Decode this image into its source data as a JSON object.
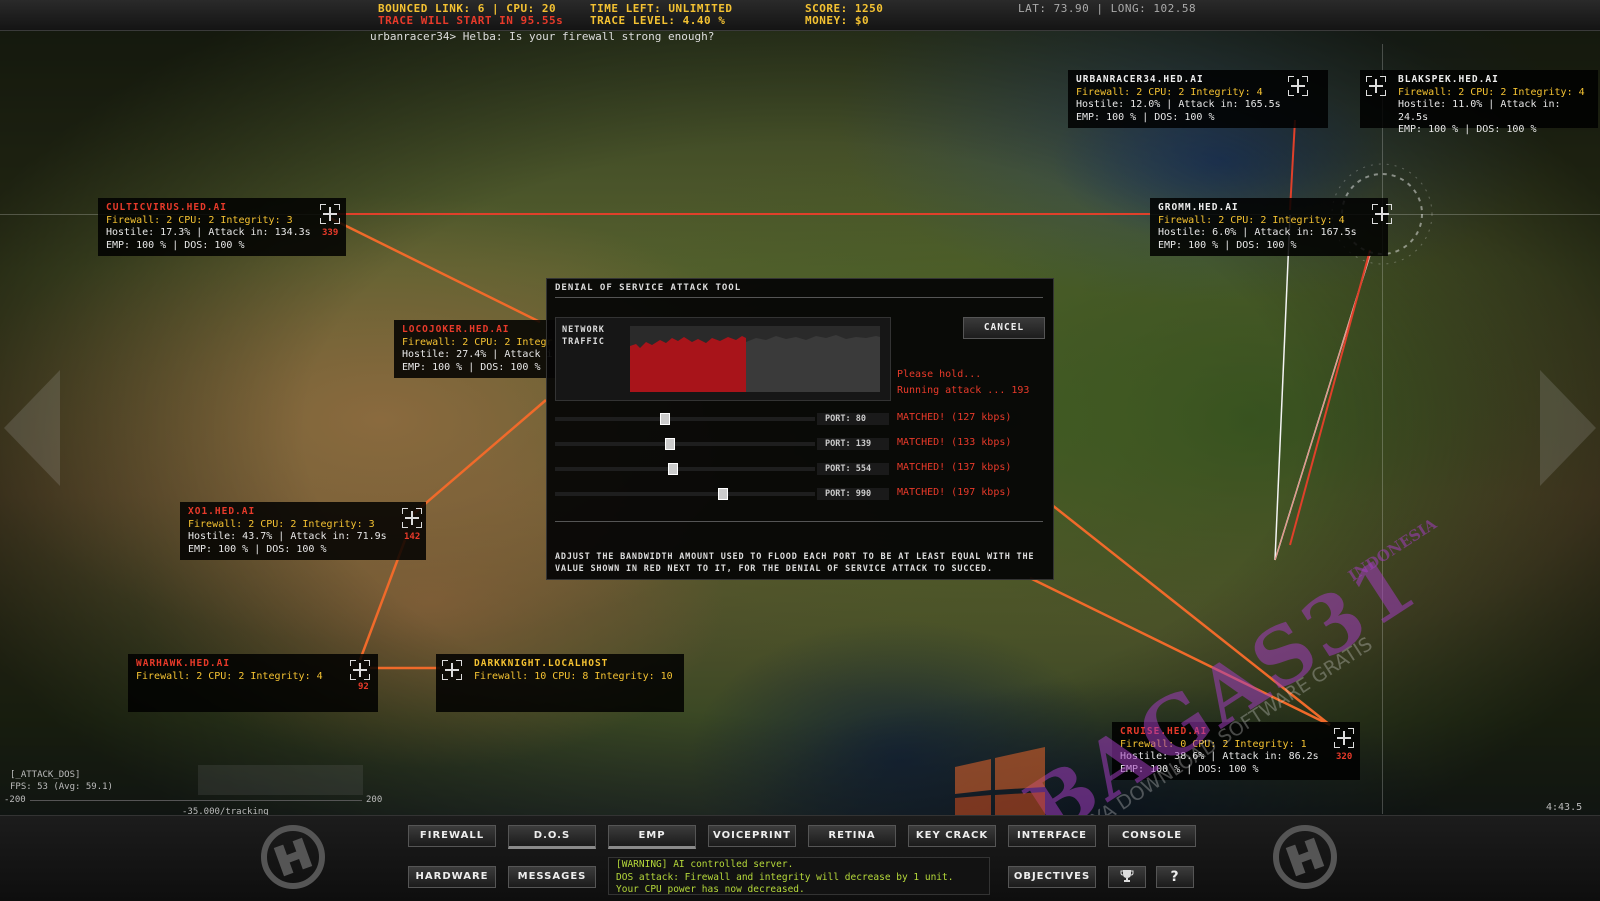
{
  "hud": {
    "bounced": "BOUNCED LINK: 6 | CPU: 20",
    "trace_start": "TRACE WILL START IN 95.55s",
    "time_left": "TIME LEFT: UNLIMITED",
    "trace_level": "TRACE LEVEL: 4.40 %",
    "score": "SCORE: 1250",
    "money": "MONEY: $0",
    "coords": "LAT: 73.90 | LONG: 102.58",
    "chat": "urbanracer34> Helba: Is your firewall strong enough?"
  },
  "nodes": {
    "urbanracer": {
      "title": "URBANRACER34.HED.AI",
      "l1": "Firewall: 2 CPU: 2 Integrity: 4",
      "l2": "Hostile: 12.0% | Attack in: 165.5s",
      "l3": "EMP: 100 % | DOS: 100 %"
    },
    "blakspek": {
      "title": "BLAKSPEK.HED.AI",
      "l1": "Firewall: 2 CPU: 2 Integrity: 4",
      "l2": "Hostile: 11.0% | Attack in: 24.5s",
      "l3": "EMP: 100 % | DOS: 100 %"
    },
    "culticvirus": {
      "title": "CULTICVIRUS.HED.AI",
      "l1": "Firewall: 2 CPU: 2 Integrity: 3",
      "l2": "Hostile: 17.3% | Attack in: 134.3s",
      "l3": "EMP: 100 % | DOS: 100 %",
      "count": "339"
    },
    "gromm": {
      "title": "GROMM.HED.AI",
      "l1": "Firewall: 2 CPU: 2 Integrity: 4",
      "l2": "Hostile: 6.0% | Attack in: 167.5s",
      "l3": "EMP: 100 % | DOS: 100 %"
    },
    "locojoker": {
      "title": "LOCOJOKER.HED.AI",
      "l1": "Firewall: 2 CPU: 2 Integr",
      "l2": "Hostile: 27.4% | Attack i",
      "l3": "EMP: 100 % | DOS: 100 %"
    },
    "xo1": {
      "title": "XO1.HED.AI",
      "l1": "Firewall: 2 CPU: 2 Integrity: 3",
      "l2": "Hostile: 43.7% | Attack in: 71.9s",
      "l3": "EMP: 100 % | DOS: 100 %",
      "count": "142"
    },
    "warhawk": {
      "title": "WARHAWK.HED.AI",
      "l1": "Firewall: 2 CPU: 2 Integrity: 4",
      "count": "92"
    },
    "darkknight": {
      "title": "DARKKNIGHT.LOCALHOST",
      "l1": "Firewall: 10 CPU: 8 Integrity: 10"
    },
    "cruise": {
      "title": "CRUISE.HED.AI",
      "l1": "Firewall: 0 CPU: 2 Integrity: 1",
      "l2": "Hostile: 38.6% | Attack in: 86.2s",
      "l3": "EMP: 100 % | DOS: 100 %",
      "count": "320"
    }
  },
  "dialog": {
    "title": "DENIAL OF SERVICE ATTACK TOOL",
    "traffic_label_1": "NETWORK",
    "traffic_label_2": "TRAFFIC",
    "cancel": "CANCEL",
    "status_1": "Please hold...",
    "status_2": "Running attack ... 193",
    "ports": [
      {
        "label": "PORT: 80",
        "matched": "MATCHED! (127 kbps)",
        "level": 0.42
      },
      {
        "label": "PORT: 139",
        "matched": "MATCHED! (133 kbps)",
        "level": 0.44
      },
      {
        "label": "PORT: 554",
        "matched": "MATCHED! (137 kbps)",
        "level": 0.45
      },
      {
        "label": "PORT: 990",
        "matched": "MATCHED! (197 kbps)",
        "level": 0.65
      }
    ],
    "help": "ADJUST THE BANDWIDTH AMOUNT USED TO FLOOD EACH PORT TO BE AT LEAST EQUAL WITH THE VALUE SHOWN IN RED NEXT TO IT, FOR THE DENIAL OF SERVICE ATTACK TO SUCCED."
  },
  "toolbar": {
    "firewall": "FIREWALL",
    "dos": "D.O.S",
    "emp": "EMP",
    "voiceprint": "VOICEPRINT",
    "retina": "RETINA",
    "keycrack": "KEY CRACK",
    "interface": "INTERFACE",
    "console": "CONSOLE",
    "hardware": "HARDWARE",
    "messages": "MESSAGES",
    "objectives": "OBJECTIVES",
    "help": "?"
  },
  "warning": {
    "l1": "[WARNING] AI controlled server.",
    "l2": "DOS attack: Firewall and integrity will decrease by 1 unit.",
    "l3": "Your CPU power has now decreased."
  },
  "debug": {
    "attack": "[_ATTACK_DOS]",
    "fps": "FPS:  53 (Avg: 59.1)",
    "left": "-200",
    "right": "200",
    "tracking": "-35.000/tracking",
    "clock": "4:43.5"
  },
  "watermark": {
    "brand": "BAGAS31",
    "country": "INDONESIA",
    "tagline": "TEMPATNYA DOWNLOAD SOFTWARE GRATIS"
  },
  "colors": {
    "hud_yellow": "#f4c232",
    "alert_red": "#e83a2a",
    "warning_green": "#b5d83a",
    "link_red": "#e0402a",
    "link_orange": "#f06a2a"
  }
}
